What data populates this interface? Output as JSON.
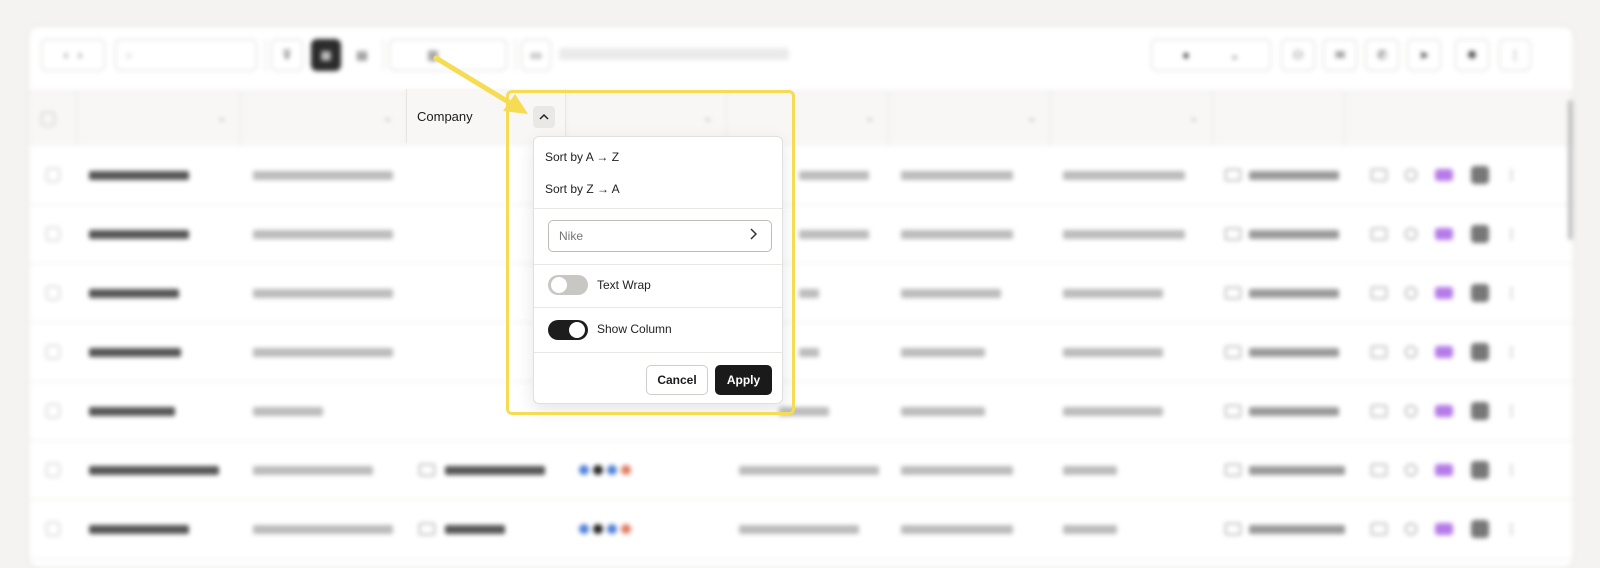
{
  "colors": {
    "accent_highlight": "#f5dc52",
    "primary_button": "#1a1a1a",
    "toggle_on": "#1d1d1d",
    "toggle_off": "#c8c7c3",
    "badge_purple": "#b57be8"
  },
  "column_menu": {
    "header_label": "Company",
    "sort_icon": "chevron-up-icon",
    "sort_asc": "Sort by A → Z",
    "sort_desc": "Sort by Z → A",
    "filter": {
      "placeholder": "Nike",
      "value": ""
    },
    "text_wrap": {
      "label": "Text Wrap",
      "enabled": false
    },
    "show_column": {
      "label": "Show Column",
      "enabled": true
    },
    "cancel_label": "Cancel",
    "apply_label": "Apply"
  }
}
